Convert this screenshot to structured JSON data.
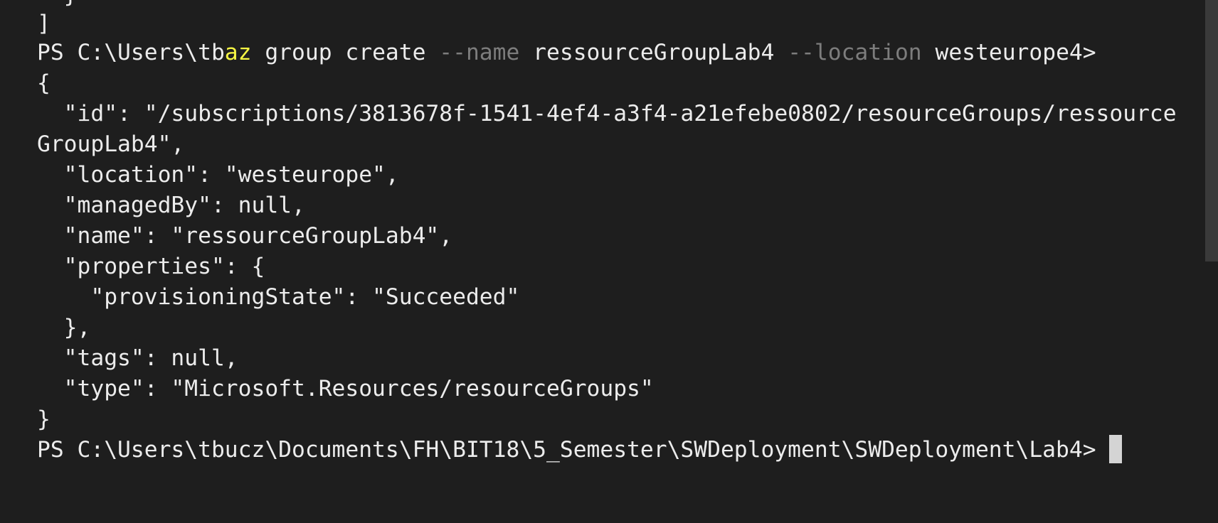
{
  "terminal": {
    "partial_top_line": "  }",
    "lines": {
      "l1": "]",
      "l2_prompt": "PS C:\\Users\\tb",
      "l2_cmd": "az",
      "l2_rest1": " group create ",
      "l2_param1": "--name",
      "l2_rest2": " ressourceGroupLab4 ",
      "l2_param2": "--location",
      "l2_rest3": " westeurope4>",
      "l3": "{",
      "l4": "  \"id\": \"/subscriptions/3813678f-1541-4ef4-a3f4-a21efebe0802/resourceGroups/ressource",
      "l5": "GroupLab4\",",
      "l6": "  \"location\": \"westeurope\",",
      "l7": "  \"managedBy\": null,",
      "l8": "  \"name\": \"ressourceGroupLab4\",",
      "l9": "  \"properties\": {",
      "l10": "    \"provisioningState\": \"Succeeded\"",
      "l11": "  },",
      "l12": "  \"tags\": null,",
      "l13": "  \"type\": \"Microsoft.Resources/resourceGroups\"",
      "l14": "}",
      "l15": "PS C:\\Users\\tbucz\\Documents\\FH\\BIT18\\5_Semester\\SWDeployment\\SWDeployment\\Lab4>"
    },
    "colors": {
      "background": "#1e1e1e",
      "text": "#ececec",
      "command": "#f5f543",
      "parameter": "#7d7d7d",
      "cursor": "#d4d4d4"
    }
  }
}
